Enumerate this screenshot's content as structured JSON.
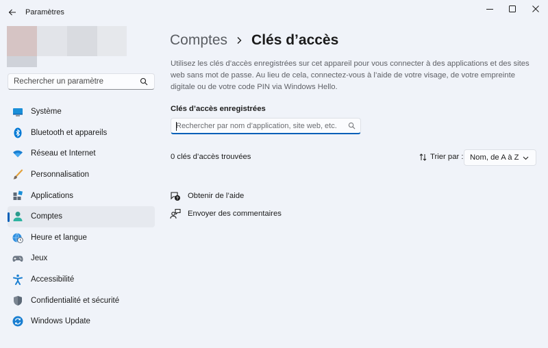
{
  "window": {
    "title": "Paramètres"
  },
  "sidebar": {
    "search_placeholder": "Rechercher un paramètre",
    "items": [
      {
        "label": "Système",
        "icon": "system-icon"
      },
      {
        "label": "Bluetooth et appareils",
        "icon": "bluetooth-icon"
      },
      {
        "label": "Réseau et Internet",
        "icon": "wifi-icon"
      },
      {
        "label": "Personnalisation",
        "icon": "brush-icon"
      },
      {
        "label": "Applications",
        "icon": "apps-icon"
      },
      {
        "label": "Comptes",
        "icon": "person-icon",
        "active": true
      },
      {
        "label": "Heure et langue",
        "icon": "clock-globe-icon"
      },
      {
        "label": "Jeux",
        "icon": "gamepad-icon"
      },
      {
        "label": "Accessibilité",
        "icon": "accessibility-icon"
      },
      {
        "label": "Confidentialité et sécurité",
        "icon": "shield-icon"
      },
      {
        "label": "Windows Update",
        "icon": "update-icon"
      }
    ]
  },
  "main": {
    "breadcrumb_parent": "Comptes",
    "breadcrumb_current": "Clés d’accès",
    "description": "Utilisez les clés d’accès enregistrées sur cet appareil pour vous connecter à des applications et des sites web sans mot de passe. Au lieu de cela, connectez-vous à l’aide de votre visage, de votre empreinte digitale ou de votre code PIN via Windows Hello.",
    "section_title": "Clés d’accès enregistrées",
    "search_placeholder": "Rechercher par nom d’application, site web, etc.",
    "count_text": "0 clés d’accès trouvées",
    "sort_label": "Trier par :",
    "sort_value": "Nom, de A à Z",
    "links": {
      "help": "Obtenir de l’aide",
      "feedback": "Envoyer des commentaires"
    }
  },
  "colors": {
    "accent": "#005fb8",
    "background": "#f0f3f9"
  }
}
